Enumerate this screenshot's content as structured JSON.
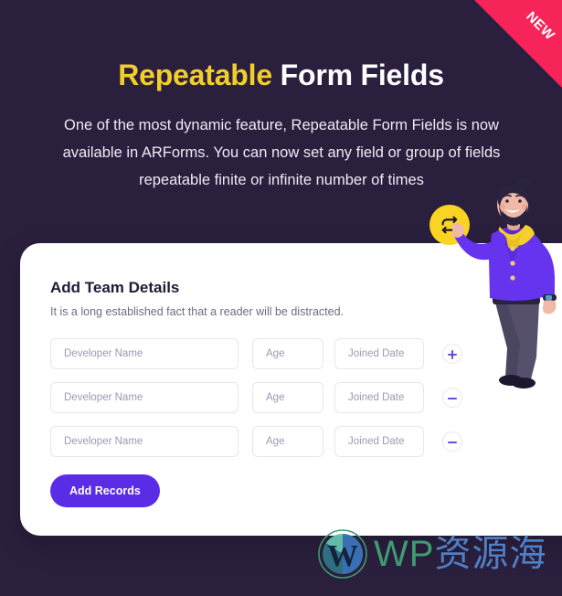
{
  "ribbon": {
    "label": "NEW",
    "color": "#f62459"
  },
  "hero": {
    "title_accent": "Repeatable",
    "title_rest": " Form Fields",
    "accent_color": "#f2ce2b",
    "subtitle": "One of the most dynamic feature, Repeatable Form Fields is now available in ARForms. You can now set any field or group of fields repeatable finite or infinite number of times"
  },
  "badge": {
    "icon": "repeat-icon",
    "color": "#f9d423"
  },
  "card": {
    "title": "Add Team Details",
    "subtitle": "It is a long established fact that a reader will be distracted.",
    "columns": [
      "Developer Name",
      "Age",
      "Joined Date"
    ],
    "rows": [
      {
        "name_placeholder": "Developer Name",
        "name_value": "",
        "age_placeholder": "Age",
        "age_value": "",
        "date_placeholder": "Joined Date",
        "date_value": "",
        "action": "add",
        "action_label": "+"
      },
      {
        "name_placeholder": "Developer Name",
        "name_value": "",
        "age_placeholder": "Age",
        "age_value": "",
        "date_placeholder": "Joined Date",
        "date_value": "",
        "action": "remove",
        "action_label": "−"
      },
      {
        "name_placeholder": "Developer Name",
        "name_value": "",
        "age_placeholder": "Age",
        "age_value": "",
        "date_placeholder": "Joined Date",
        "date_value": "",
        "action": "remove",
        "action_label": "−"
      }
    ],
    "submit_label": "Add Records",
    "submit_color": "#5b2ce8"
  },
  "illustration": {
    "name": "bearded-man-holding-badge",
    "jacket_color": "#6633ee",
    "scarf_color": "#f5cf2e",
    "pants_color": "#4b4660",
    "skin_color": "#f0b9a6"
  },
  "watermark": {
    "logo": "wordpress-icon",
    "text_en": "WP",
    "text_cn": "资源海"
  },
  "theme": {
    "background": "#2a1f3d",
    "card_background": "#ffffff",
    "field_border": "#e8e6f0",
    "placeholder": "#9a99b6",
    "accent_purple": "#6c4ae0"
  }
}
